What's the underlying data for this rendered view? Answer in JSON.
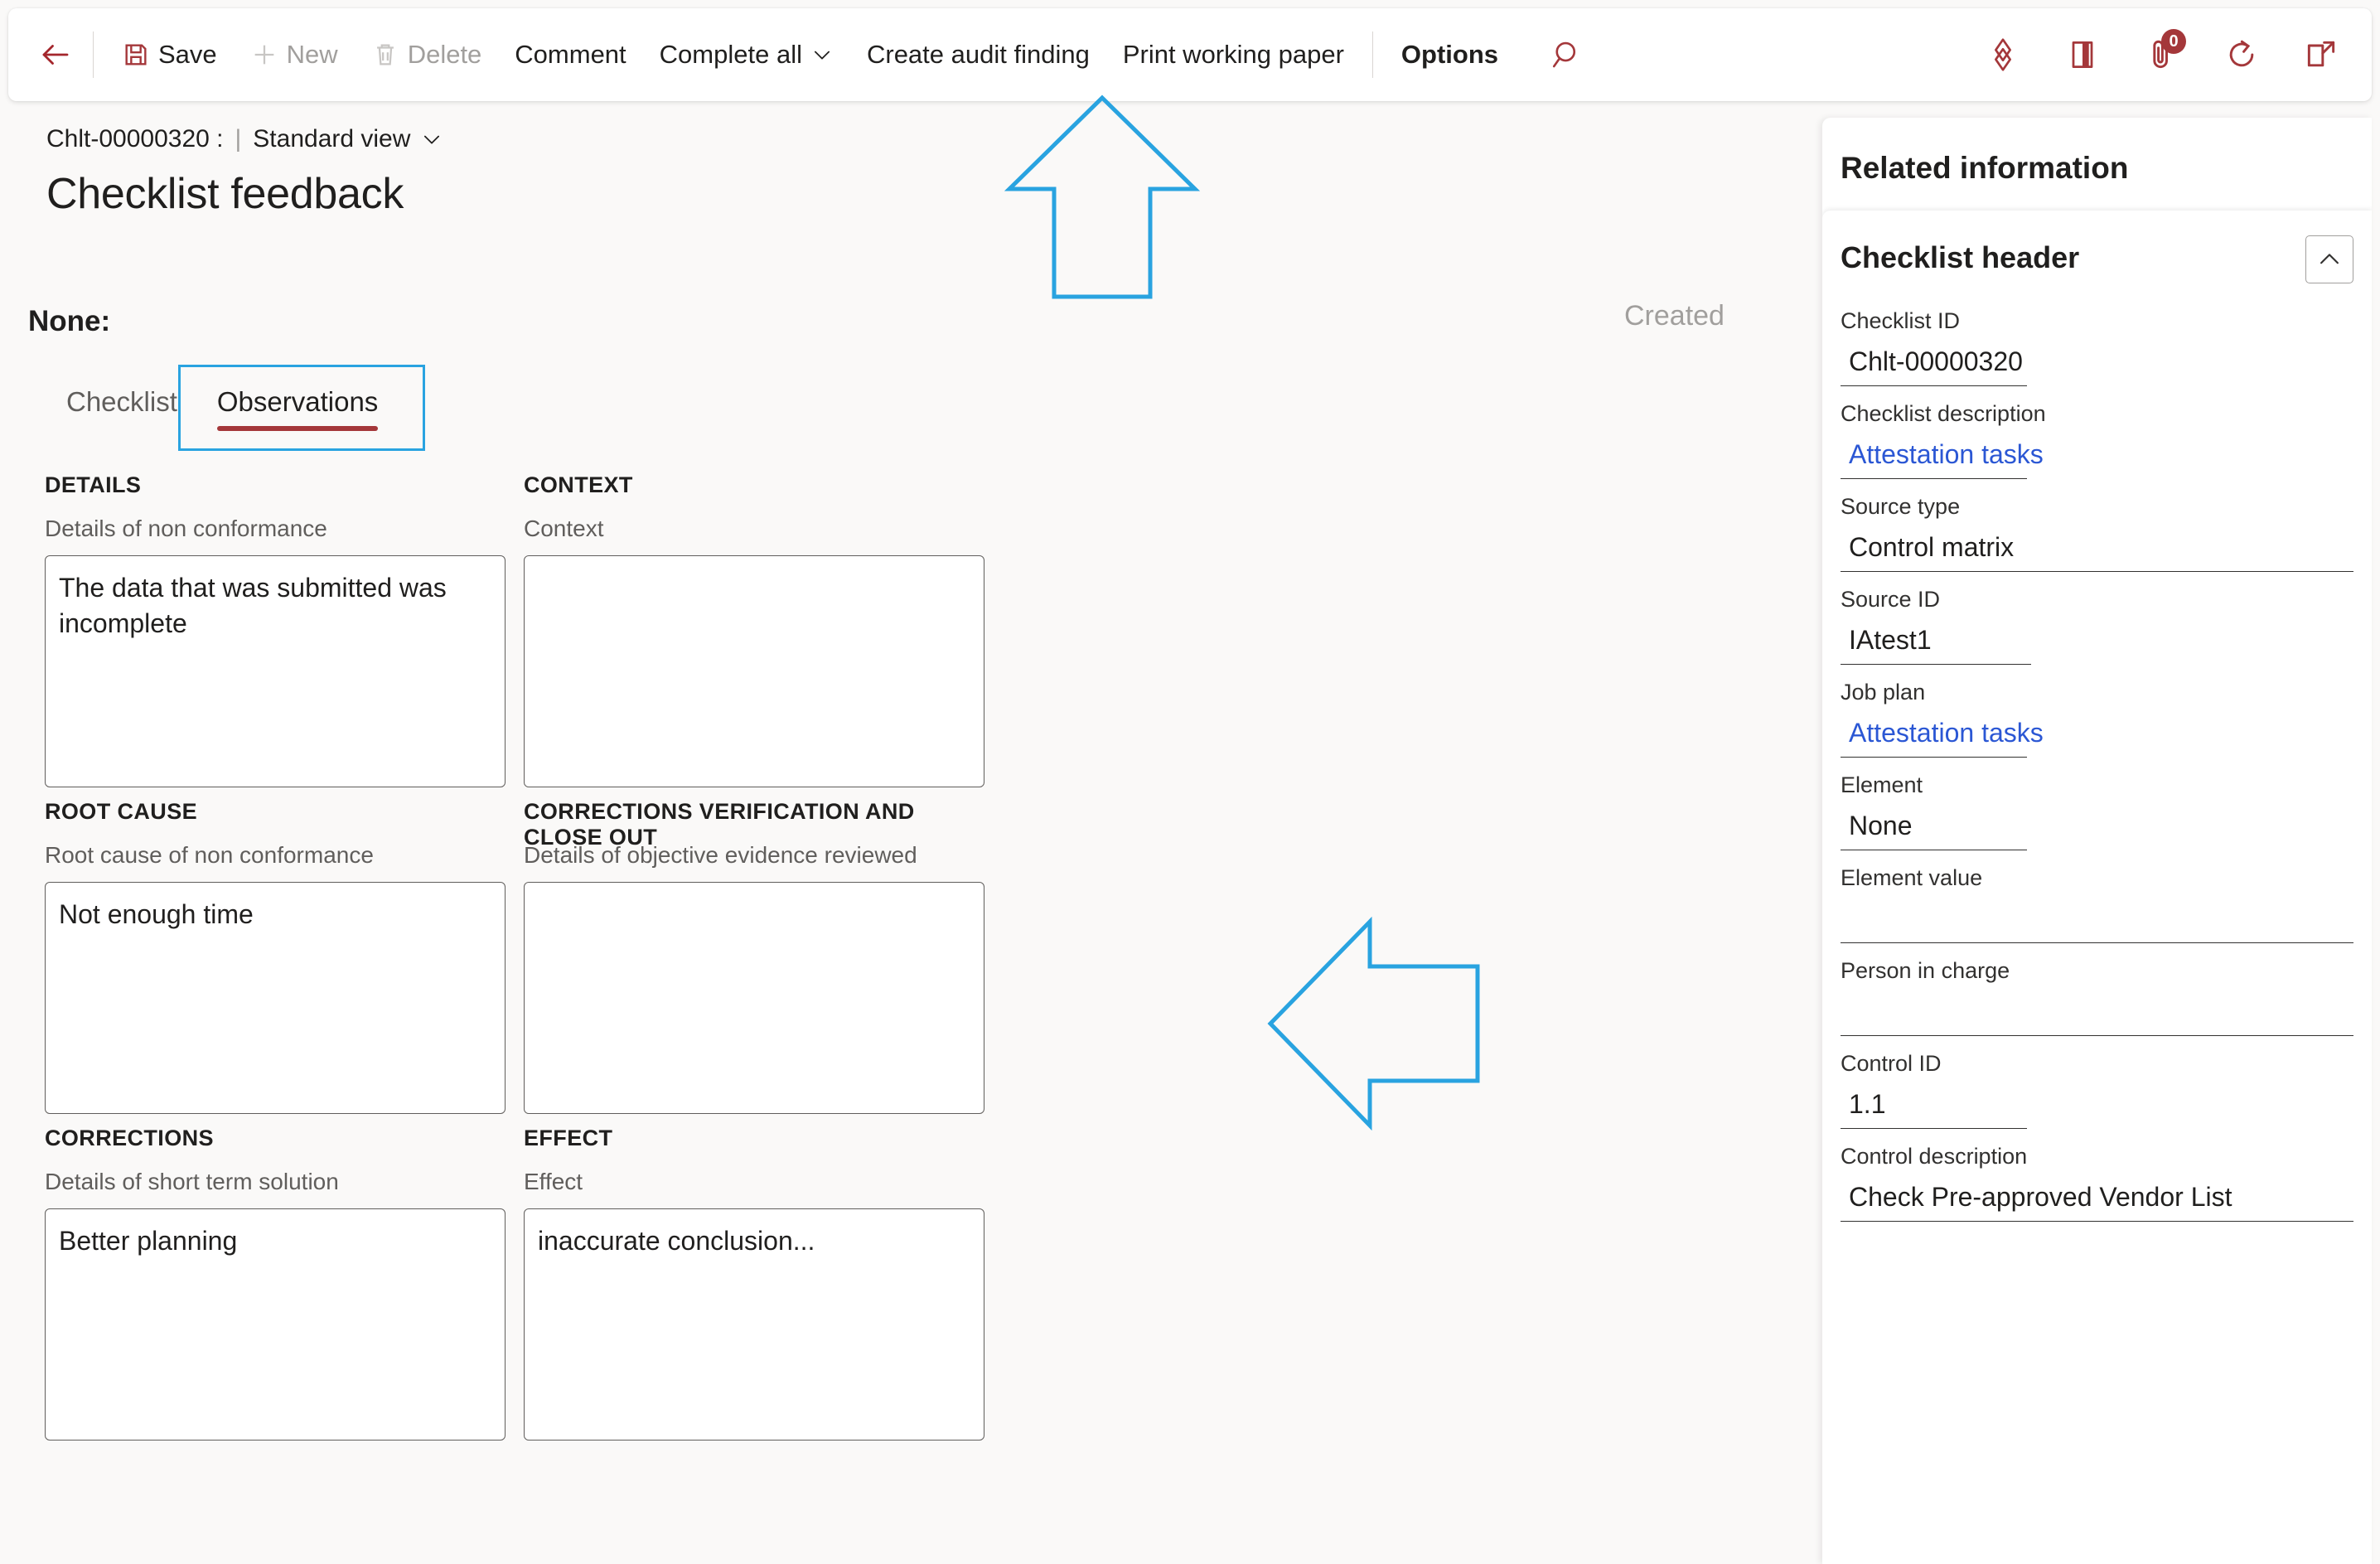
{
  "toolbar": {
    "back_label": "Back",
    "buttons": [
      {
        "label": "Save",
        "icon": "save-icon",
        "disabled": false,
        "bold": false
      },
      {
        "label": "New",
        "icon": "plus-icon",
        "disabled": true,
        "bold": false
      },
      {
        "label": "Delete",
        "icon": "trash-icon",
        "disabled": true,
        "bold": false
      },
      {
        "label": "Comment",
        "icon": null,
        "disabled": false,
        "bold": false
      },
      {
        "label": "Complete all",
        "icon": "chevron-down-icon",
        "disabled": false,
        "bold": false
      },
      {
        "label": "Create audit finding",
        "icon": null,
        "disabled": false,
        "bold": false
      },
      {
        "label": "Print working paper",
        "icon": null,
        "disabled": false,
        "bold": false
      },
      {
        "label": "Options",
        "icon": null,
        "disabled": false,
        "bold": true
      }
    ],
    "right_icons": [
      {
        "name": "search-icon",
        "badge": null
      },
      {
        "name": "personalize-icon",
        "badge": null
      },
      {
        "name": "open-panel-icon",
        "badge": null
      },
      {
        "name": "attachment-icon",
        "badge": "0"
      },
      {
        "name": "refresh-icon",
        "badge": null
      },
      {
        "name": "popout-icon",
        "badge": null
      }
    ],
    "accent_color": "#a4373a"
  },
  "header": {
    "record_id": "Chlt-00000320 :",
    "separator": "|",
    "view_name": "Standard view",
    "title": "Checklist feedback",
    "group_label": "None:",
    "status": "Created"
  },
  "tabs": [
    {
      "label": "Checklist",
      "active": false
    },
    {
      "label": "Observations",
      "active": true
    }
  ],
  "form": {
    "sections": [
      {
        "heading": "DETAILS",
        "field_label": "Details of non conformance",
        "value": "The data that was submitted was incomplete"
      },
      {
        "heading": "CONTEXT",
        "field_label": "Context",
        "value": ""
      },
      {
        "heading": "ROOT CAUSE",
        "field_label": "Root cause of non conformance",
        "value": "Not enough time"
      },
      {
        "heading": "CORRECTIONS VERIFICATION AND CLOSE OUT",
        "field_label": "Details of objective evidence reviewed",
        "value": ""
      },
      {
        "heading": "CORRECTIONS",
        "field_label": "Details of short term solution",
        "value": "Better planning"
      },
      {
        "heading": "EFFECT",
        "field_label": "Effect",
        "value": "inaccurate conclusion..."
      }
    ]
  },
  "related_panel": {
    "title": "Related information",
    "card_title": "Checklist header",
    "collapse_icon": "chevron-up-icon",
    "fields": [
      {
        "label": "Checklist ID",
        "value": "Chlt-00000320",
        "link": false
      },
      {
        "label": "Checklist description",
        "value": "Attestation tasks",
        "link": true
      },
      {
        "label": "Source type",
        "value": "Control matrix",
        "link": false
      },
      {
        "label": "Source ID",
        "value": "IAtest1",
        "link": false
      },
      {
        "label": "Job plan",
        "value": "Attestation tasks",
        "link": true
      },
      {
        "label": "Element",
        "value": "None",
        "link": false
      },
      {
        "label": "Element value",
        "value": "",
        "link": false
      },
      {
        "label": "Person in charge",
        "value": "",
        "link": false
      },
      {
        "label": "Control ID",
        "value": "1.1",
        "link": false
      },
      {
        "label": "Control description",
        "value": "Check Pre-approved Vendor List",
        "link": false
      }
    ]
  },
  "annotations": [
    {
      "name": "arrow-up-annotation",
      "direction": "up",
      "color": "#29a3e0"
    },
    {
      "name": "arrow-left-annotation",
      "direction": "left",
      "color": "#29a3e0"
    }
  ]
}
